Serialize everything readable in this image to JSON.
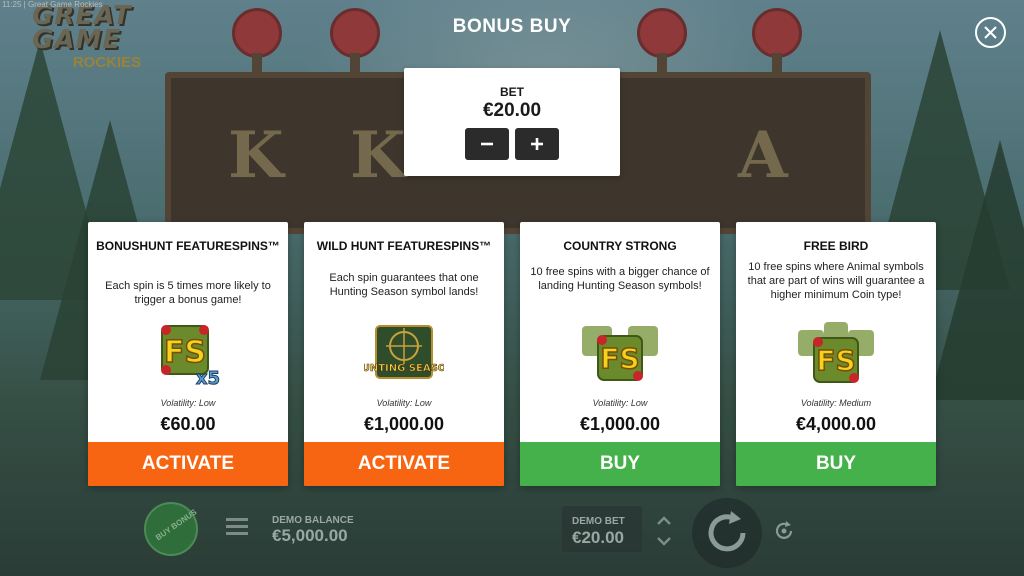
{
  "window": {
    "title": "11:25 | Great Game Rockies"
  },
  "logo": {
    "line1": "GREAT",
    "line2": "GAME",
    "line3": "ROCKIES"
  },
  "board_letters": [
    "K",
    "K",
    "A"
  ],
  "modal": {
    "title": "BONUS BUY",
    "close_icon": "close-icon",
    "bet": {
      "label": "BET",
      "value": "€20.00",
      "decrease_icon": "minus-icon",
      "increase_icon": "plus-icon"
    }
  },
  "cards": [
    {
      "title": "BONUSHUNT FEATURESPINS™",
      "description": "Each spin is 5 times more likely to trigger a bonus game!",
      "icon": "fs-x5-icon",
      "icon_text": "FS",
      "icon_badge": "x5",
      "volatility": "Volatility: Low",
      "price": "€60.00",
      "button": "ACTIVATE",
      "button_color": "#f86512"
    },
    {
      "title": "WILD HUNT FEATURESPINS™",
      "description": "Each spin guarantees that one Hunting Season symbol lands!",
      "icon": "hunting-season-icon",
      "icon_text": "HUNTING SEASON",
      "volatility": "Volatility: Low",
      "price": "€1,000.00",
      "button": "ACTIVATE",
      "button_color": "#f86512"
    },
    {
      "title": "COUNTRY STRONG",
      "description": "10 free spins with a bigger chance of landing Hunting Season symbols!",
      "icon": "fs-stack-icon",
      "icon_text": "FS",
      "volatility": "Volatility: Low",
      "price": "€1,000.00",
      "button": "BUY",
      "button_color": "#45b14a"
    },
    {
      "title": "FREE BIRD",
      "description": "10 free spins where Animal symbols that are part of wins will guarantee a higher minimum Coin type!",
      "icon": "fs-stack-icon",
      "icon_text": "FS",
      "volatility": "Volatility: Medium",
      "price": "€4,000.00",
      "button": "BUY",
      "button_color": "#45b14a"
    }
  ],
  "bottom_bar": {
    "buy_bonus": "BUY BONUS",
    "menu_icon": "hamburger-menu-icon",
    "balance_label": "DEMO BALANCE",
    "balance_value": "€5,000.00",
    "bet_label": "DEMO BET",
    "bet_value": "€20.00",
    "bet_up_icon": "chevron-up-icon",
    "bet_down_icon": "chevron-down-icon",
    "spin_icon": "spin-arrow-icon",
    "autoplay_icon": "autoplay-icon"
  }
}
